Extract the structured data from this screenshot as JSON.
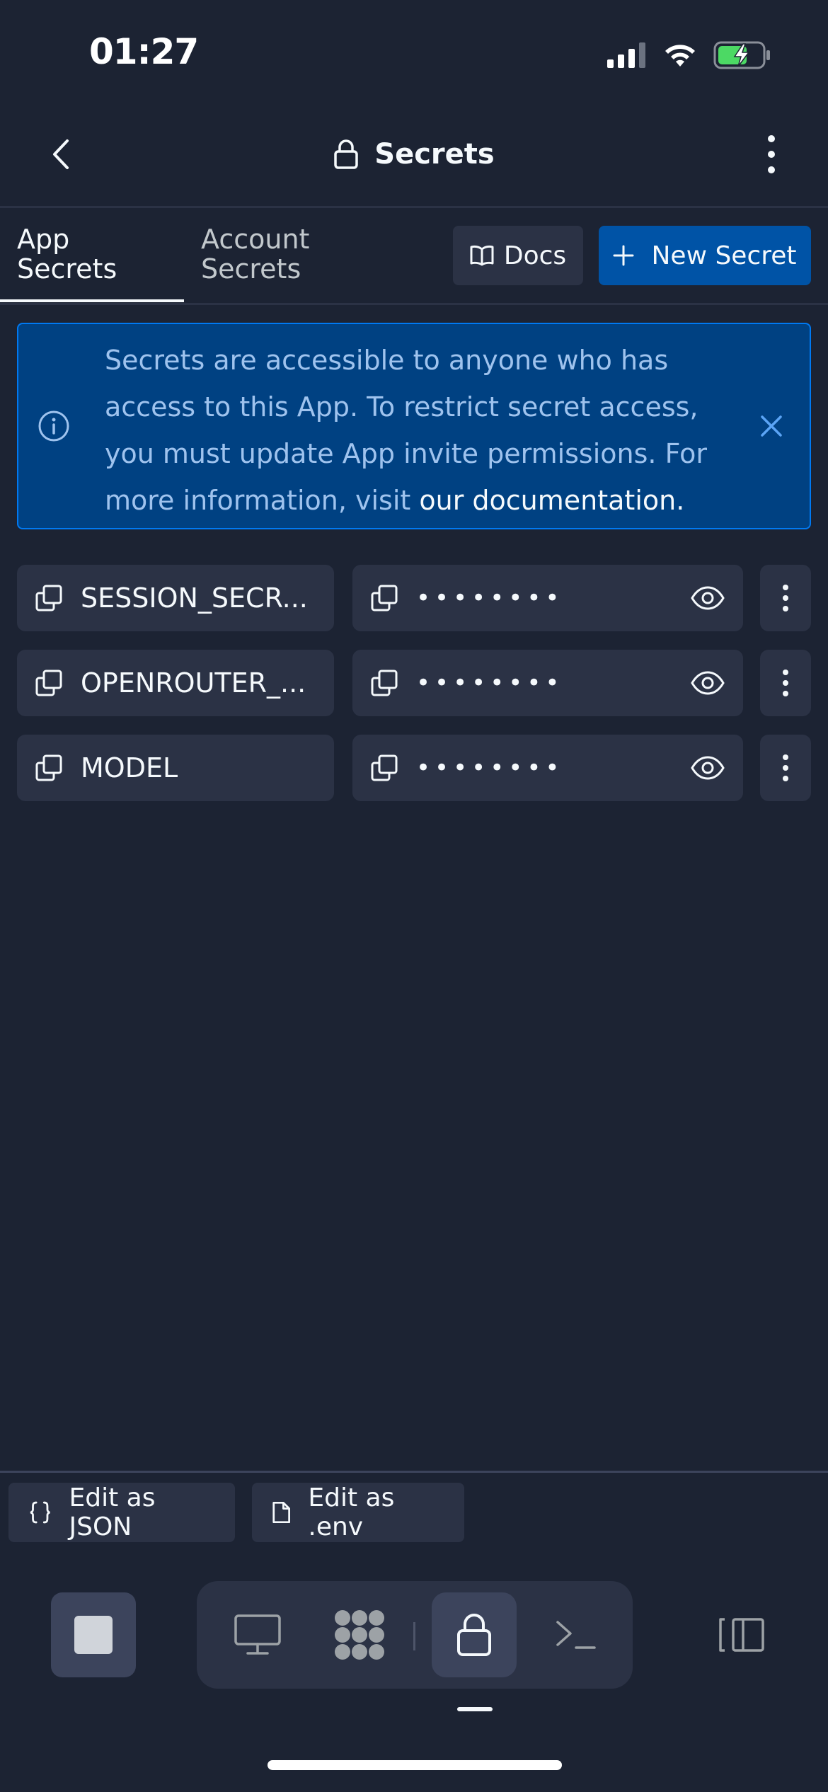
{
  "status_bar": {
    "time": "01:27",
    "signal_icon": "cellular-signal-icon",
    "wifi_icon": "wifi-icon",
    "battery_icon": "battery-charging-icon",
    "battery_color": "#4cd964"
  },
  "nav": {
    "title": "Secrets",
    "title_icon": "lock-icon",
    "back_icon": "chevron-left-icon",
    "menu_icon": "more-vertical-icon"
  },
  "tabs": [
    {
      "label_line1": "App",
      "label_line2": "Secrets",
      "active": true
    },
    {
      "label_line1": "Account",
      "label_line2": "Secrets",
      "active": false
    }
  ],
  "actions": {
    "docs_label": "Docs",
    "docs_icon": "book-icon",
    "new_secret_label": "New Secret",
    "new_secret_icon": "plus-icon"
  },
  "banner": {
    "text": "Secrets are accessible to anyone who has access to this App. To restrict secret access, you must update App invite permissions. For more information, visit ",
    "link_text": "our documentation.",
    "info_icon": "info-icon",
    "close_icon": "close-icon",
    "accent_color": "#0079f2"
  },
  "secrets": [
    {
      "key": "SESSION_SECR...",
      "value_masked": "••••••••"
    },
    {
      "key": "OPENROUTER_...",
      "value_masked": "••••••••"
    },
    {
      "key": "MODEL",
      "value_masked": "••••••••"
    }
  ],
  "bottom_actions": {
    "edit_json_label": "Edit as JSON",
    "edit_json_icon": "braces-icon",
    "edit_env_label": "Edit as .env",
    "edit_env_icon": "file-icon"
  },
  "dock": {
    "stop_icon": "stop-icon",
    "items": [
      "monitor-icon",
      "agent-icon",
      "lock-icon",
      "terminal-icon"
    ],
    "active_item": "lock-icon",
    "layout_icon": "layout-panel-icon"
  },
  "colors": {
    "background": "#1c2333",
    "surface": "#2b3245",
    "primary": "#0053a6",
    "banner_bg": "#004182"
  }
}
